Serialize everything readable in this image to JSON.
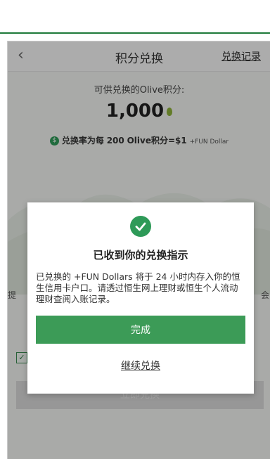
{
  "header": {
    "title": "积分兑换",
    "history_link": "兑换记录",
    "back_icon": "chevron-left-icon"
  },
  "balance": {
    "label": "可供兑换的Olive积分:",
    "points": "1,000",
    "rate_prefix": "兑换率为每",
    "rate_amount": "200",
    "rate_unit": "Olive积分=",
    "rate_value": "$1",
    "rate_suffix": "+FUN Dollar"
  },
  "background": {
    "text_left": "提",
    "text_right": "会",
    "button_label": "立即兑换"
  },
  "modal": {
    "title": "已收到你的兑换指示",
    "body": "已兑换的 +FUN Dollars 将于 24 小时内存入你的恒生信用卡户口。请透过恒生网上理财或恒生个人流动理财查阅入账记录。",
    "done_label": "完成",
    "continue_label": "继续兑换"
  },
  "colors": {
    "brand_green": "#2e9a58",
    "button_green": "#3c9b57",
    "top_line": "#1e7a3a"
  }
}
